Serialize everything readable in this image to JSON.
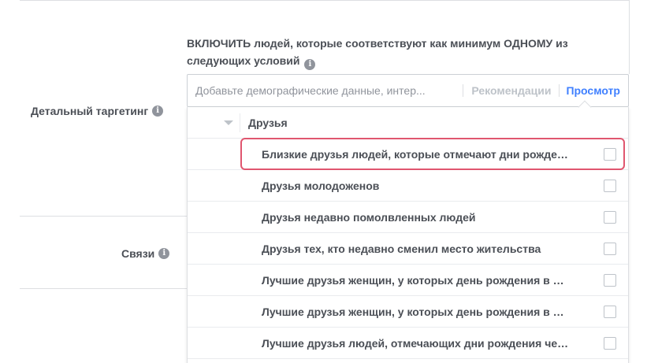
{
  "section": {
    "detailed_targeting_label": "Детальный таргетинг",
    "connections_label": "Связи"
  },
  "include": {
    "text": "ВКЛЮЧИТЬ людей, которые соответствуют как минимум ОДНОМУ из следующих условий"
  },
  "search": {
    "placeholder": "Добавьте демографические данные, интер...",
    "recommendations_label": "Рекомендации",
    "browse_label": "Просмотр"
  },
  "dropdown": {
    "category": "Друзья",
    "items": [
      {
        "label": "Близкие друзья людей, которые отмечают дни рожде…"
      },
      {
        "label": "Друзья молодоженов"
      },
      {
        "label": "Друзья недавно помолвленных людей"
      },
      {
        "label": "Друзья тех, кто недавно сменил место жительства"
      },
      {
        "label": "Лучшие друзья женщин, у которых день рождения в …"
      },
      {
        "label": "Лучшие друзья женщин, у которых день рождения в …"
      },
      {
        "label": "Лучшие друзья людей, отмечающих дни рождения че…"
      }
    ]
  },
  "colors": {
    "link": "#4080ff",
    "highlight": "#e0566f",
    "label_text": "#4b4f56"
  }
}
